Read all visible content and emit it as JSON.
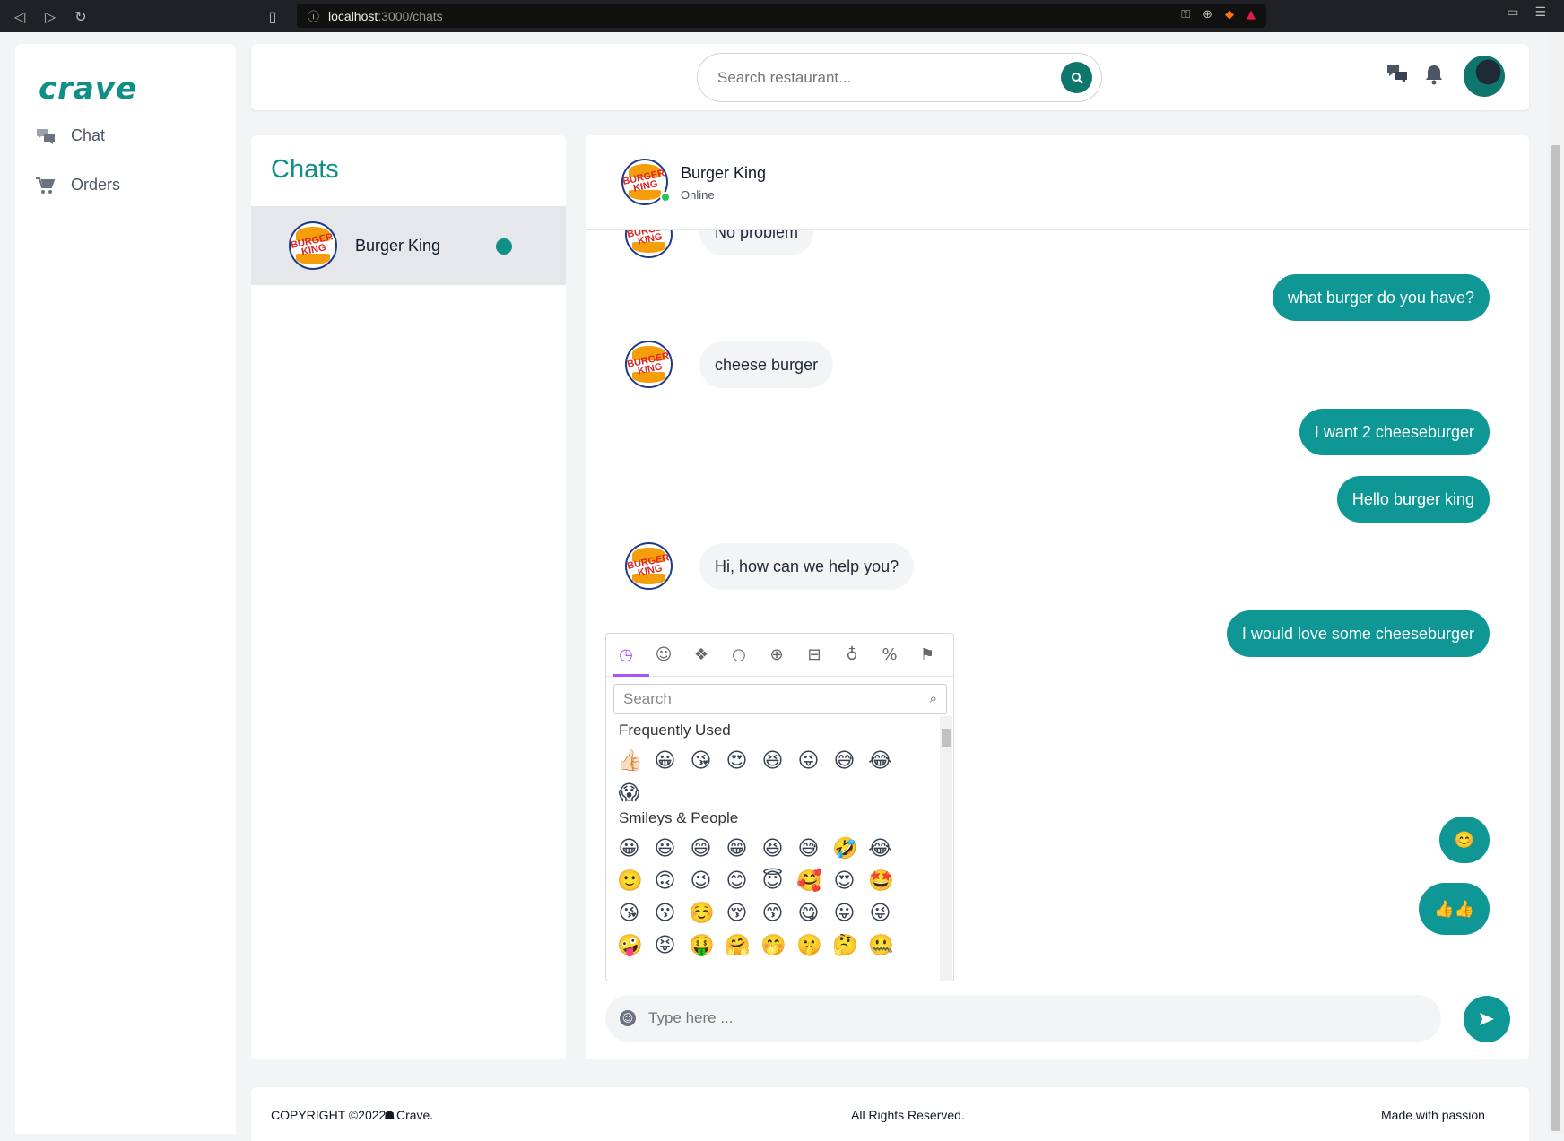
{
  "browser": {
    "url_host": "localhost",
    "url_path": ":3000/chats"
  },
  "sidebar": {
    "logo": "crave",
    "items": [
      {
        "label": "Chat",
        "icon": "chat-bubbles-icon"
      },
      {
        "label": "Orders",
        "icon": "cart-icon"
      }
    ]
  },
  "header": {
    "search_placeholder": "Search restaurant..."
  },
  "chats": {
    "title": "Chats",
    "entries": [
      {
        "name": "Burger King"
      }
    ]
  },
  "conversation": {
    "name": "Burger King",
    "status": "Online",
    "messages": [
      {
        "side": "in",
        "text": "No problem"
      },
      {
        "side": "out",
        "text": "what burger do you have?"
      },
      {
        "side": "in",
        "text": "cheese burger"
      },
      {
        "side": "out",
        "text": "I want 2 cheeseburger"
      },
      {
        "side": "out",
        "text": "Hello burger king"
      },
      {
        "side": "in",
        "text": "Hi, how can we help you?"
      },
      {
        "side": "out",
        "text": "I would love some cheeseburger"
      },
      {
        "side": "out",
        "text": "😊"
      },
      {
        "side": "out",
        "text": "👍👍"
      }
    ],
    "input_placeholder": "Type here ..."
  },
  "emoji_picker": {
    "search_placeholder": "Search",
    "categories": [
      "recent-icon",
      "smiley-icon",
      "animal-icon",
      "food-icon",
      "activity-icon",
      "travel-icon",
      "object-icon",
      "symbol-icon",
      "flag-icon"
    ],
    "sections": [
      {
        "label": "Frequently Used",
        "rows": [
          [
            "👍🏻",
            "😀",
            "😘",
            "😍",
            "😆",
            "😜",
            "😅",
            "😂"
          ],
          [
            "😱"
          ]
        ]
      },
      {
        "label": "Smileys & People",
        "rows": [
          [
            "😀",
            "😃",
            "😄",
            "😁",
            "😆",
            "😅",
            "🤣",
            "😂"
          ],
          [
            "🙂",
            "🙃",
            "😉",
            "😊",
            "😇",
            "🥰",
            "😍",
            "🤩"
          ],
          [
            "😘",
            "😗",
            "☺️",
            "😚",
            "😙",
            "😋",
            "😛",
            "😜"
          ],
          [
            "🤪",
            "😝",
            "🤑",
            "🤗",
            "🤭",
            "🤫",
            "🤔",
            "🤐"
          ]
        ]
      }
    ]
  },
  "footer": {
    "copyright": "COPYRIGHT ©2022",
    "brand": "Crave.",
    "center": "All Rights Reserved.",
    "right": "Made with passion"
  },
  "colors": {
    "accent": "#0e9794",
    "brand": "#0f8f85",
    "online": "#22c55e"
  }
}
